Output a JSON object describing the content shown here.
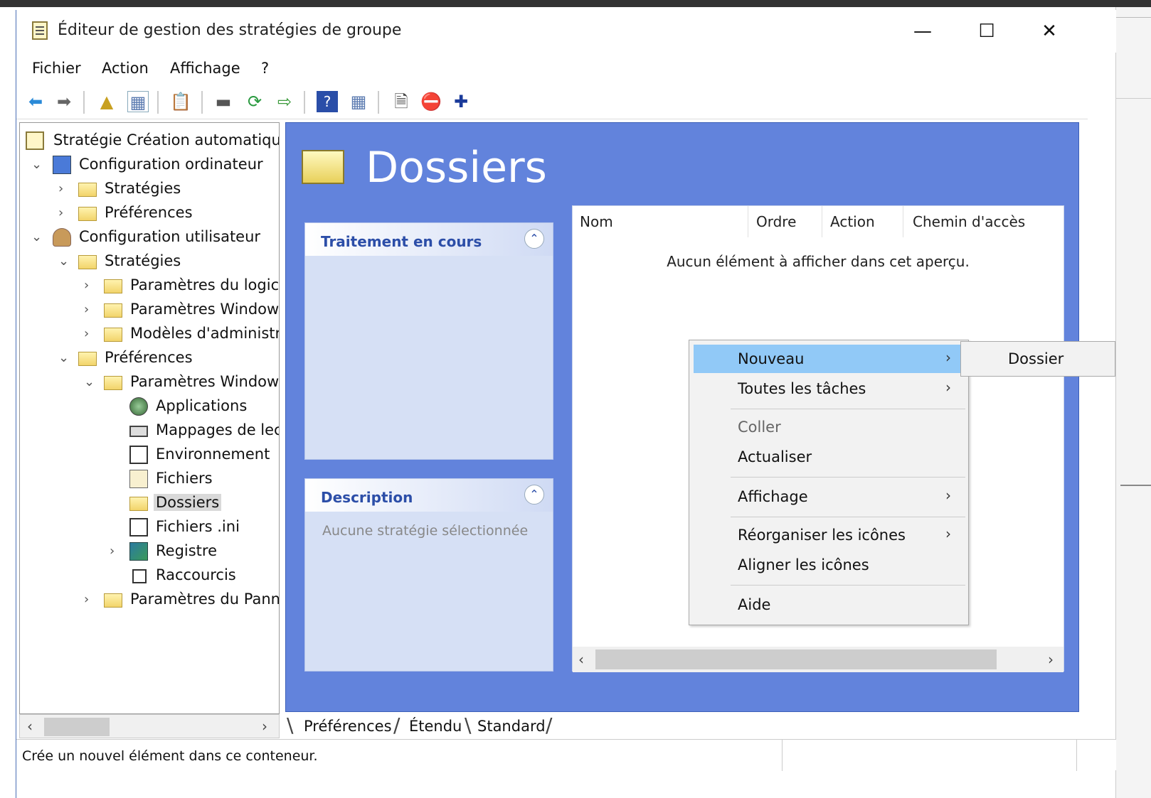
{
  "window": {
    "title": "Éditeur de gestion des stratégies de groupe",
    "minimize": "—",
    "maximize": "☐",
    "close": "✕"
  },
  "menu": {
    "file": "Fichier",
    "action": "Action",
    "view": "Affichage",
    "help": "?"
  },
  "tree": {
    "root": "Stratégie Création automatique",
    "computer_config": "Configuration ordinateur",
    "cc_policies": "Stratégies",
    "cc_preferences": "Préférences",
    "user_config": "Configuration utilisateur",
    "uc_policies": "Stratégies",
    "uc_software": "Paramètres du logici",
    "uc_windows": "Paramètres Window:",
    "uc_admin": "Modèles d'administr",
    "uc_preferences": "Préférences",
    "pref_windows": "Paramètres Window:",
    "applications": "Applications",
    "drive_maps": "Mappages de lec",
    "environment": "Environnement",
    "files": "Fichiers",
    "folders": "Dossiers",
    "ini_files": "Fichiers .ini",
    "registry": "Registre",
    "shortcuts": "Raccourcis",
    "control_panel": "Paramètres du Pann"
  },
  "content": {
    "title": "Dossiers",
    "processing_panel": {
      "title": "Traitement en cours"
    },
    "description_panel": {
      "title": "Description",
      "text": "Aucune stratégie sélectionnée"
    },
    "columns": [
      "Nom",
      "Ordre",
      "Action",
      "Chemin d'accès"
    ],
    "empty_message": "Aucun élément à afficher dans cet aperçu."
  },
  "context_menu": {
    "new": "Nouveau",
    "all_tasks": "Toutes les tâches",
    "paste": "Coller",
    "refresh": "Actualiser",
    "view": "Affichage",
    "arrange_icons": "Réorganiser les icônes",
    "align_icons": "Aligner les icônes",
    "help": "Aide"
  },
  "submenu": {
    "folder": "Dossier"
  },
  "tabs": [
    "Préférences",
    "Étendu",
    "Standard"
  ],
  "status": {
    "text": "Crée un nouvel élément dans ce conteneur."
  },
  "colors": {
    "content_bg": "#6283dc",
    "highlight": "#91c9f7",
    "panel_title": "#2c4ea8"
  }
}
